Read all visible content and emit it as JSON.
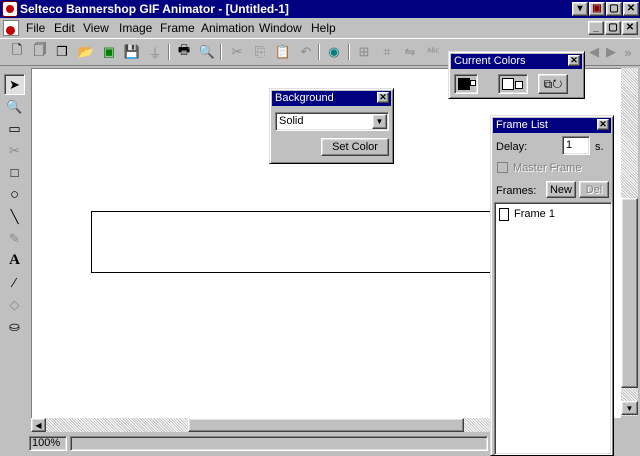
{
  "window": {
    "title": "Selteco Bannershop GIF Animator - [Untitled-1]",
    "caption_buttons": [
      "▾",
      "▣",
      "▢",
      "✕"
    ],
    "mdi_buttons": [
      "_",
      "▢",
      "✕"
    ]
  },
  "menu": {
    "items": [
      "File",
      "Edit",
      "View",
      "Image",
      "Frame",
      "Animation",
      "Window",
      "Help"
    ]
  },
  "toolbar": {
    "icons": [
      "new-icon",
      "new-frame-icon",
      "copy-frame-icon",
      "open-icon",
      "import-icon",
      "save-icon",
      "filter-icon",
      "print-icon",
      "print-preview-icon",
      "cut-icon",
      "copy-icon",
      "paste-icon",
      "undo-icon",
      "preview-animation-icon",
      "resize-icon",
      "crop-icon",
      "flip-icon",
      "text-effect-icon"
    ]
  },
  "tools": {
    "icons": [
      "pointer-icon",
      "zoom-icon",
      "rectangle-select-icon",
      "lasso-icon",
      "rectangle-icon",
      "ellipse-icon",
      "line-icon",
      "pencil-icon",
      "text-icon",
      "eyedropper-icon",
      "eraser-icon",
      "fill-bucket-icon"
    ]
  },
  "background_panel": {
    "title": "Background",
    "fill_type": "Solid",
    "set_color_label": "Set Color"
  },
  "current_colors_panel": {
    "title": "Current Colors",
    "foreground": "#000000",
    "background": "#ffffff"
  },
  "frame_list_panel": {
    "title": "Frame List",
    "delay_label": "Delay:",
    "delay_value": "1",
    "delay_unit": "s.",
    "master_frame_label": "Master Frame",
    "frames_label": "Frames:",
    "new_label": "New",
    "del_label": "Del",
    "frames": [
      "Frame 1"
    ]
  },
  "status": {
    "zoom": "100%"
  }
}
